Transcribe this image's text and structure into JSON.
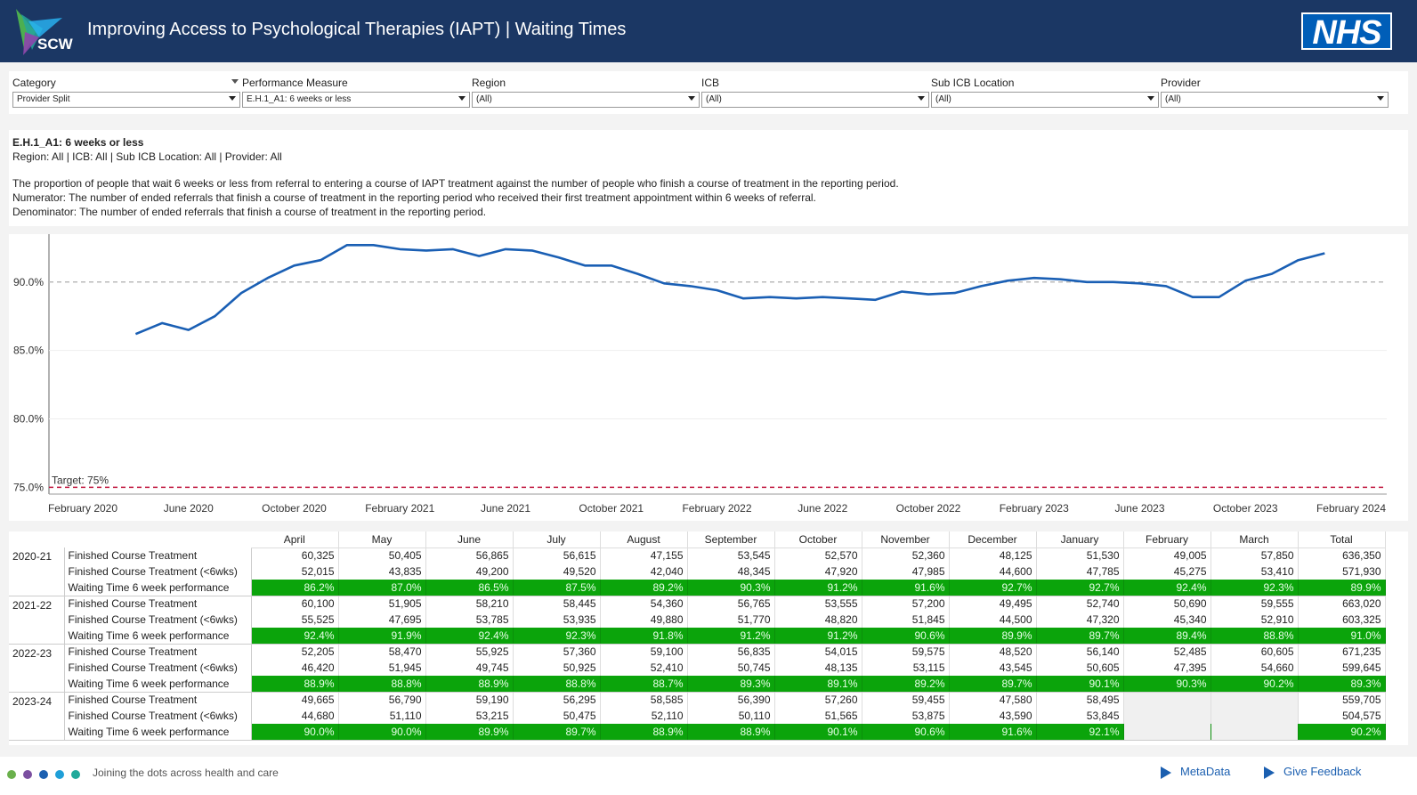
{
  "header": {
    "logo_text": "SCW",
    "title": "Improving Access to Psychological Therapies (IAPT) | Waiting Times",
    "brand": "NHS"
  },
  "filters": [
    {
      "label": "Category",
      "value": "Provider Split"
    },
    {
      "label": "Performance Measure",
      "value": "E.H.1_A1: 6 weeks or less"
    },
    {
      "label": "Region",
      "value": "(All)"
    },
    {
      "label": "ICB",
      "value": "(All)"
    },
    {
      "label": "Sub ICB Location",
      "value": "(All)"
    },
    {
      "label": "Provider",
      "value": "(All)"
    }
  ],
  "description": {
    "heading": "E.H.1_A1: 6 weeks or less",
    "selection": "Region: All | ICB: All | Sub ICB Location: All | Provider: All",
    "line1": "The proportion of people that wait 6 weeks or less from referral to entering a course of IAPT treatment against the number of people who finish a course of treatment in the reporting period.",
    "line2": "Numerator: The number of ended referrals that finish a course of treatment in the reporting period who received their first treatment appointment within 6 weeks of referral.",
    "line3": "Denominator: The number of ended referrals that finish a course of treatment in the reporting period."
  },
  "chart_data": {
    "type": "line",
    "x_tick_labels": [
      "February 2020",
      "June 2020",
      "October 2020",
      "February 2021",
      "June 2021",
      "October 2021",
      "February 2022",
      "June 2022",
      "October 2022",
      "February 2023",
      "June 2023",
      "October 2023",
      "February 2024"
    ],
    "y_tick_labels": [
      "75.0%",
      "80.0%",
      "85.0%",
      "90.0%"
    ],
    "ylim": [
      74.5,
      93.5
    ],
    "target_label": "Target: 75%",
    "target_value": 75.0,
    "reference_value": 90.0,
    "series": [
      {
        "x": [
          "2020-04",
          "2020-05",
          "2020-06",
          "2020-07",
          "2020-08",
          "2020-09",
          "2020-10",
          "2020-11",
          "2020-12",
          "2021-01",
          "2021-02",
          "2021-03",
          "2021-04",
          "2021-05",
          "2021-06",
          "2021-07",
          "2021-08",
          "2021-09",
          "2021-10",
          "2021-11",
          "2021-12",
          "2022-01",
          "2022-02",
          "2022-03",
          "2022-04",
          "2022-05",
          "2022-06",
          "2022-07",
          "2022-08",
          "2022-09",
          "2022-10",
          "2022-11",
          "2022-12",
          "2023-01",
          "2023-02",
          "2023-03",
          "2023-04",
          "2023-05",
          "2023-06",
          "2023-07",
          "2023-08",
          "2023-09",
          "2023-10",
          "2023-11",
          "2023-12",
          "2024-01"
        ],
        "values": [
          86.2,
          87.0,
          86.5,
          87.5,
          89.2,
          90.3,
          91.2,
          91.6,
          92.7,
          92.7,
          92.4,
          92.3,
          92.4,
          91.9,
          92.4,
          92.3,
          91.8,
          91.2,
          91.2,
          90.6,
          89.9,
          89.7,
          89.4,
          88.8,
          88.9,
          88.8,
          88.9,
          88.8,
          88.7,
          89.3,
          89.1,
          89.2,
          89.7,
          90.1,
          90.3,
          90.2,
          90.0,
          90.0,
          89.9,
          89.7,
          88.9,
          88.9,
          90.1,
          90.6,
          91.6,
          92.1
        ]
      }
    ]
  },
  "table": {
    "columns": [
      "April",
      "May",
      "June",
      "July",
      "August",
      "September",
      "October",
      "November",
      "December",
      "January",
      "February",
      "March",
      "Total"
    ],
    "groups": [
      {
        "year": "2020-21",
        "rows": [
          {
            "measure": "Finished Course Treatment",
            "values": [
              "60,325",
              "50,405",
              "56,865",
              "56,615",
              "47,155",
              "53,545",
              "52,570",
              "52,360",
              "48,125",
              "51,530",
              "49,005",
              "57,850",
              "636,350"
            ]
          },
          {
            "measure": "Finished Course Treatment (<6wks)",
            "values": [
              "52,015",
              "43,835",
              "49,200",
              "49,520",
              "42,040",
              "48,345",
              "47,920",
              "47,985",
              "44,600",
              "47,785",
              "45,275",
              "53,410",
              "571,930"
            ]
          },
          {
            "measure": "Waiting Time 6 week performance",
            "values": [
              "86.2%",
              "87.0%",
              "86.5%",
              "87.5%",
              "89.2%",
              "90.3%",
              "91.2%",
              "91.6%",
              "92.7%",
              "92.7%",
              "92.4%",
              "92.3%",
              "89.9%"
            ]
          }
        ]
      },
      {
        "year": "2021-22",
        "rows": [
          {
            "measure": "Finished Course Treatment",
            "values": [
              "60,100",
              "51,905",
              "58,210",
              "58,445",
              "54,360",
              "56,765",
              "53,555",
              "57,200",
              "49,495",
              "52,740",
              "50,690",
              "59,555",
              "663,020"
            ]
          },
          {
            "measure": "Finished Course Treatment (<6wks)",
            "values": [
              "55,525",
              "47,695",
              "53,785",
              "53,935",
              "49,880",
              "51,770",
              "48,820",
              "51,845",
              "44,500",
              "47,320",
              "45,340",
              "52,910",
              "603,325"
            ]
          },
          {
            "measure": "Waiting Time 6 week performance",
            "values": [
              "92.4%",
              "91.9%",
              "92.4%",
              "92.3%",
              "91.8%",
              "91.2%",
              "91.2%",
              "90.6%",
              "89.9%",
              "89.7%",
              "89.4%",
              "88.8%",
              "91.0%"
            ]
          }
        ]
      },
      {
        "year": "2022-23",
        "rows": [
          {
            "measure": "Finished Course Treatment",
            "values": [
              "52,205",
              "58,470",
              "55,925",
              "57,360",
              "59,100",
              "56,835",
              "54,015",
              "59,575",
              "48,520",
              "56,140",
              "52,485",
              "60,605",
              "671,235"
            ]
          },
          {
            "measure": "Finished Course Treatment (<6wks)",
            "values": [
              "46,420",
              "51,945",
              "49,745",
              "50,925",
              "52,410",
              "50,745",
              "48,135",
              "53,115",
              "43,545",
              "50,605",
              "47,395",
              "54,660",
              "599,645"
            ]
          },
          {
            "measure": "Waiting Time 6 week performance",
            "values": [
              "88.9%",
              "88.8%",
              "88.9%",
              "88.8%",
              "88.7%",
              "89.3%",
              "89.1%",
              "89.2%",
              "89.7%",
              "90.1%",
              "90.3%",
              "90.2%",
              "89.3%"
            ]
          }
        ]
      },
      {
        "year": "2023-24",
        "rows": [
          {
            "measure": "Finished Course Treatment",
            "values": [
              "49,665",
              "56,790",
              "59,190",
              "56,295",
              "58,585",
              "56,390",
              "57,260",
              "59,455",
              "47,580",
              "58,495",
              "",
              "",
              "559,705"
            ]
          },
          {
            "measure": "Finished Course Treatment (<6wks)",
            "values": [
              "44,680",
              "51,110",
              "53,215",
              "50,475",
              "52,110",
              "50,110",
              "51,565",
              "53,875",
              "43,590",
              "53,845",
              "",
              "",
              "504,575"
            ]
          },
          {
            "measure": "Waiting Time 6 week performance",
            "values": [
              "90.0%",
              "90.0%",
              "89.9%",
              "89.7%",
              "88.9%",
              "88.9%",
              "90.1%",
              "90.6%",
              "91.6%",
              "92.1%",
              "",
              "",
              "90.2%"
            ]
          }
        ]
      }
    ]
  },
  "footer": {
    "tagline": "Joining the dots across health and care",
    "metadata_label": "MetaData",
    "feedback_label": "Give Feedback",
    "dot_colors": [
      "#6ab04c",
      "#7b4fa0",
      "#1b5fb0",
      "#1f9fd8",
      "#20a99a"
    ]
  },
  "colors": {
    "header_bg": "#1b3764",
    "line": "#1a5fb4",
    "target": "#c0143c",
    "reference": "#bbbbbb",
    "good": "#0ba40b"
  }
}
